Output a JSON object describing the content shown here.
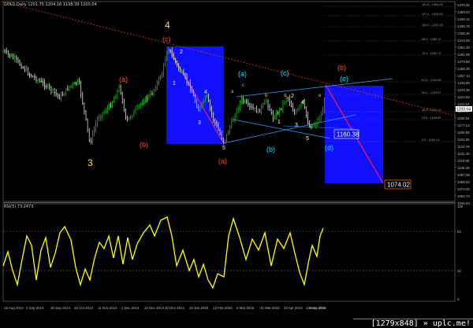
{
  "chart_title": "GOLD,Daily  1201.75 1204.16 1198.39 1200.04",
  "oscillator_title": "RSI(5) 73.2473",
  "watermark": "[1279x848] » uplc.me!",
  "colors": {
    "background": "#000000",
    "bull_bar": "#20d020",
    "bear_bar": "#ffffff",
    "wave_orange": "#ff5010",
    "wave_cyan": "#00e0ff",
    "wave_yellow": "#ffe020",
    "box_blue": "#1010ff",
    "rsi_line": "#ffff00",
    "axis_text": "#bbbbbb"
  },
  "price_axis_labels": [
    "1370.25",
    "1359.03",
    "1348.12",
    "1336.79",
    "1325.30",
    "1314.05",
    "1302.32",
    "1291.08",
    "1279.89",
    "1268.39",
    "1257.13",
    "1245.88",
    "1234.39",
    "1222.94",
    "1211.64",
    "1200.04",
    "1188.54",
    "1177.13",
    "1165.85",
    "1154.06",
    "1142.76",
    "1131.40",
    "1119.98",
    "1108.49",
    "1097.05",
    "1085.53",
    "1074.02",
    "1062.73",
    "1046.63"
  ],
  "rsi_axis_labels": [
    "100",
    "82",
    "32",
    "0"
  ],
  "date_axis_labels": [
    "15 Aug 2014",
    "4 Sep 2014",
    "30 Sep 2014",
    "20 Oct 2014",
    "11 Nov 2014",
    "1 Dec 2014",
    "22 Dec 2014",
    "30 Dec 2014",
    "22 Jan 2015",
    "13 Feb 2015",
    "6 Mar 2015",
    "31 Mar 2015",
    "22 Apr 2015",
    "12 May 2015",
    "1 Jun 2015",
    "8 Jun 2015"
  ],
  "fib_labels": [
    "161.8 - 1359.05",
    "127.2 - 1318.93",
    "100.0 - 1292.35",
    "88.6 - 1280.11",
    "76.4 - 1262.72",
    "61.8 - 1244.69",
    "50.0 - 1229.87",
    "38.2 - 1215.13",
    "23.6 - 1196.83",
    "0.0 - 1162.14"
  ],
  "wave_labels": {
    "major_3": "3",
    "major_4": "4",
    "c_top": "(c)",
    "a_left": "(a)",
    "b_left": "(b)",
    "a_low": "(a)",
    "b_right": "(b)",
    "a_cyan": "(a)",
    "b_cyan": "(b)",
    "c_cyan": "(c)",
    "d_cyan": "(d)",
    "e_cyan": "(e)",
    "n1": "1",
    "n2": "2",
    "n3": "3",
    "n4": "4",
    "n5": "5",
    "m1": "1",
    "m2": "2",
    "m3": "3",
    "m4": "4",
    "m5": "5",
    "sa": "a",
    "sb": "b",
    "sc": "c",
    "sd": "d",
    "se": "e"
  },
  "price_tags": {
    "current_price": "1200.04",
    "target_1": "1160.38",
    "target_2": "1074.02"
  }
}
